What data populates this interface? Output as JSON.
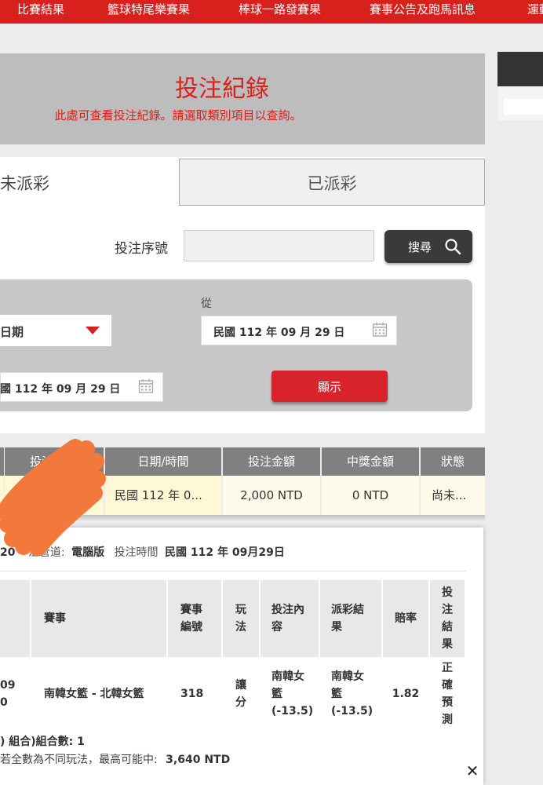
{
  "nav": {
    "items": [
      "比賽結果",
      "籃球特尾樂賽果",
      "棒球一路發賽果",
      "賽事公告及跑馬訊息",
      "運動"
    ]
  },
  "header": {
    "title": "投注紀錄",
    "subtitle": "此處可查看投注紀錄。請選取類別項目以查詢。"
  },
  "tabs": {
    "unpaid": "未派彩",
    "paid": "已派彩"
  },
  "search": {
    "serial_label": "投注序號",
    "serial_value": "",
    "button_label": "搜尋"
  },
  "filter": {
    "date_type": "日期",
    "from_label": "從",
    "from_date": "民國 112 年 09 月 29 日",
    "to_date": "國 112 年 09 月 29 日",
    "show_label": "顯示"
  },
  "summary": {
    "headers": [
      "投注序",
      "日期/時間",
      "投注金額",
      "中獎金額",
      "狀態"
    ],
    "row": {
      "datetime": "民國 112 年 0...",
      "amount": "2,000 NTD",
      "winning": "0 NTD",
      "status": "尚未..."
    }
  },
  "detail": {
    "info_prefix": "20",
    "channel_label": "注管道:",
    "channel_value": "電腦版",
    "time_label": "投注時間",
    "time_value": "民國 112 年 09月29日",
    "headers": {
      "event": "賽事",
      "event_no": "賽事編號",
      "play": "玩法",
      "content": "投注內容",
      "result": "派彩結果",
      "odds": "賠率",
      "bet_result": "投注結果"
    },
    "row": {
      "date_partial_1": "09",
      "date_partial_2": "0",
      "event": "南韓女籃 - 北韓女籃",
      "event_no": "318",
      "play": "讓分",
      "content": "南韓女籃 (-13.5)",
      "result": "南韓女籃 (-13.5)",
      "odds": "1.82",
      "bet_result": "正確預測"
    },
    "combo_line": ") 組合)組合數: 1",
    "max_prefix": "若全數為不同玩法，最高可能中:",
    "max_value": "3,640 NTD"
  }
}
